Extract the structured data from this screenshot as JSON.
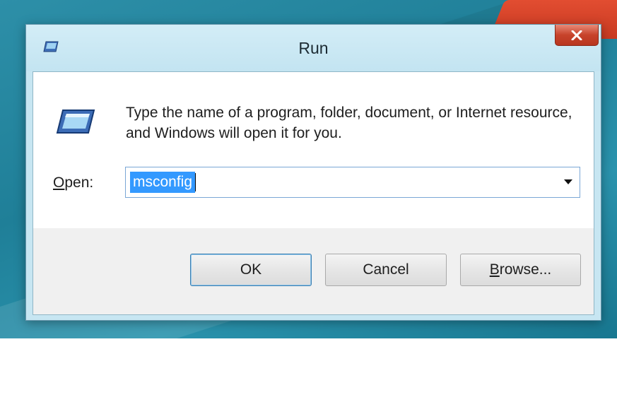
{
  "window": {
    "title": "Run",
    "close_symbol": "x",
    "icon": "run-program-icon"
  },
  "dialog": {
    "description": "Type the name of a program, folder, document, or Internet resource, and Windows will open it for you.",
    "open_label_accel": "O",
    "open_label_rest": "pen:",
    "input_value": "msconfig",
    "input_selected": true
  },
  "buttons": {
    "ok": "OK",
    "cancel": "Cancel",
    "browse_accel": "B",
    "browse_rest": "rowse..."
  },
  "colors": {
    "titlebar": "#c7e6f2",
    "close": "#c7432b",
    "selection": "#3399ff",
    "desktop": "#1f7f98"
  }
}
